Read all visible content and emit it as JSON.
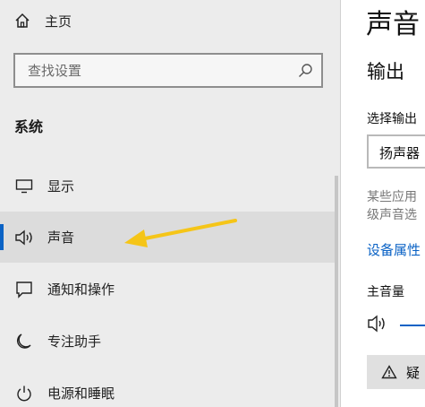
{
  "sidebar": {
    "home_label": "主页",
    "search_placeholder": "查找设置",
    "section_title": "系统",
    "items": [
      {
        "label": "显示",
        "icon": "monitor-icon"
      },
      {
        "label": "声音",
        "icon": "speaker-icon",
        "active": true
      },
      {
        "label": "通知和操作",
        "icon": "message-icon"
      },
      {
        "label": "专注助手",
        "icon": "moon-icon"
      },
      {
        "label": "电源和睡眠",
        "icon": "power-icon"
      }
    ]
  },
  "main": {
    "title": "声音",
    "output_heading": "输出",
    "choose_output_label": "选择输出",
    "output_device": "扬声器",
    "desc_line1": "某些应用",
    "desc_line2": "级声音选",
    "device_properties_link": "设备属性",
    "master_volume_label": "主音量",
    "troubleshoot_label": "疑"
  },
  "colors": {
    "accent": "#0a62c5",
    "annotation_arrow": "#f5c518"
  }
}
